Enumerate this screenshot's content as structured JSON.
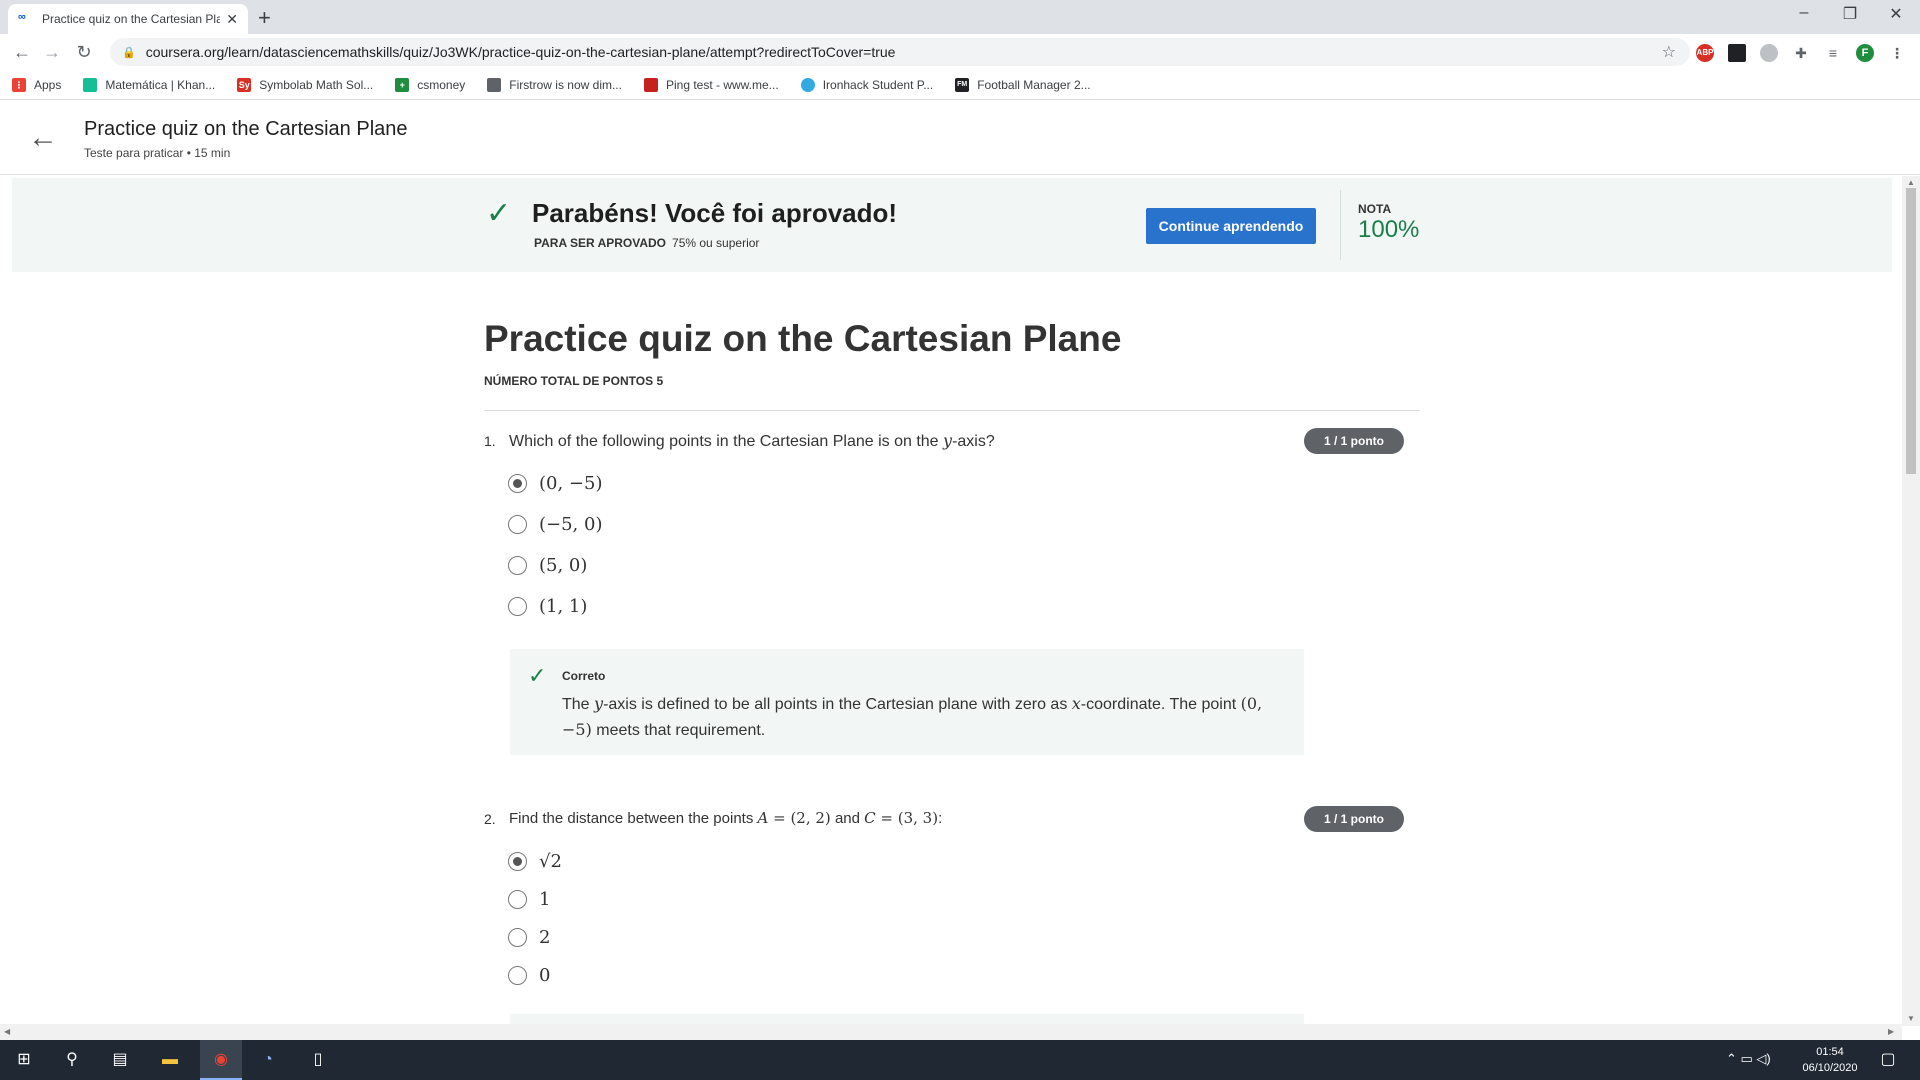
{
  "browser": {
    "tab_title": "Practice quiz on the Cartesian Pla",
    "tab_icon": "coursera-icon",
    "url": "coursera.org/learn/datasciencemathskills/quiz/Jo3WK/practice-quiz-on-the-cartesian-plane/attempt?redirectToCover=true",
    "profile_initial": "F",
    "ext_abp": "ABP"
  },
  "bookmarks": [
    {
      "label": "Apps",
      "color": "#ea4335"
    },
    {
      "label": "Matemática | Khan...",
      "color": "#14bf96"
    },
    {
      "label": "Symbolab Math Sol...",
      "color": "#d93025",
      "icon_text": "Sy"
    },
    {
      "label": "csmoney",
      "color": "#1e8e3e"
    },
    {
      "label": "Firstrow is now dim...",
      "color": "#5f6368"
    },
    {
      "label": "Ping test - www.me...",
      "color": "#c5221f"
    },
    {
      "label": "Ironhack Student P...",
      "color": "#32a9e1"
    },
    {
      "label": "Football Manager 2...",
      "color": "#202124",
      "icon_text": "FM"
    }
  ],
  "header": {
    "title": "Practice quiz on the Cartesian Plane",
    "subtitle": "Teste para praticar • 15 min"
  },
  "banner": {
    "title": "Parabéns! Você foi aprovado!",
    "req_label": "PARA SER APROVADO",
    "req_value": "75% ou superior",
    "continue_label": "Continue aprendendo",
    "nota_label": "NOTA",
    "nota_value": "100%"
  },
  "quiz": {
    "title": "Practice quiz on the Cartesian Plane",
    "total_points": "NÚMERO TOTAL DE PONTOS 5"
  },
  "questions": [
    {
      "number": "1.",
      "badge": "1 / 1 ponto",
      "options": [
        "(0, −5)",
        "(−5, 0)",
        "(5, 0)",
        "(1, 1)"
      ],
      "selected": 0,
      "feedback_label": "Correto"
    },
    {
      "number": "2.",
      "badge": "1 / 1 ponto",
      "options": [
        "√2",
        "1",
        "2",
        "0"
      ],
      "selected": 0
    }
  ],
  "taskbar": {
    "time": "01:54",
    "date": "06/10/2020"
  },
  "colors": {
    "accent_green": "#1b7f4a",
    "button_blue": "#2a73cc",
    "banner_bg": "#f2f7f5"
  }
}
